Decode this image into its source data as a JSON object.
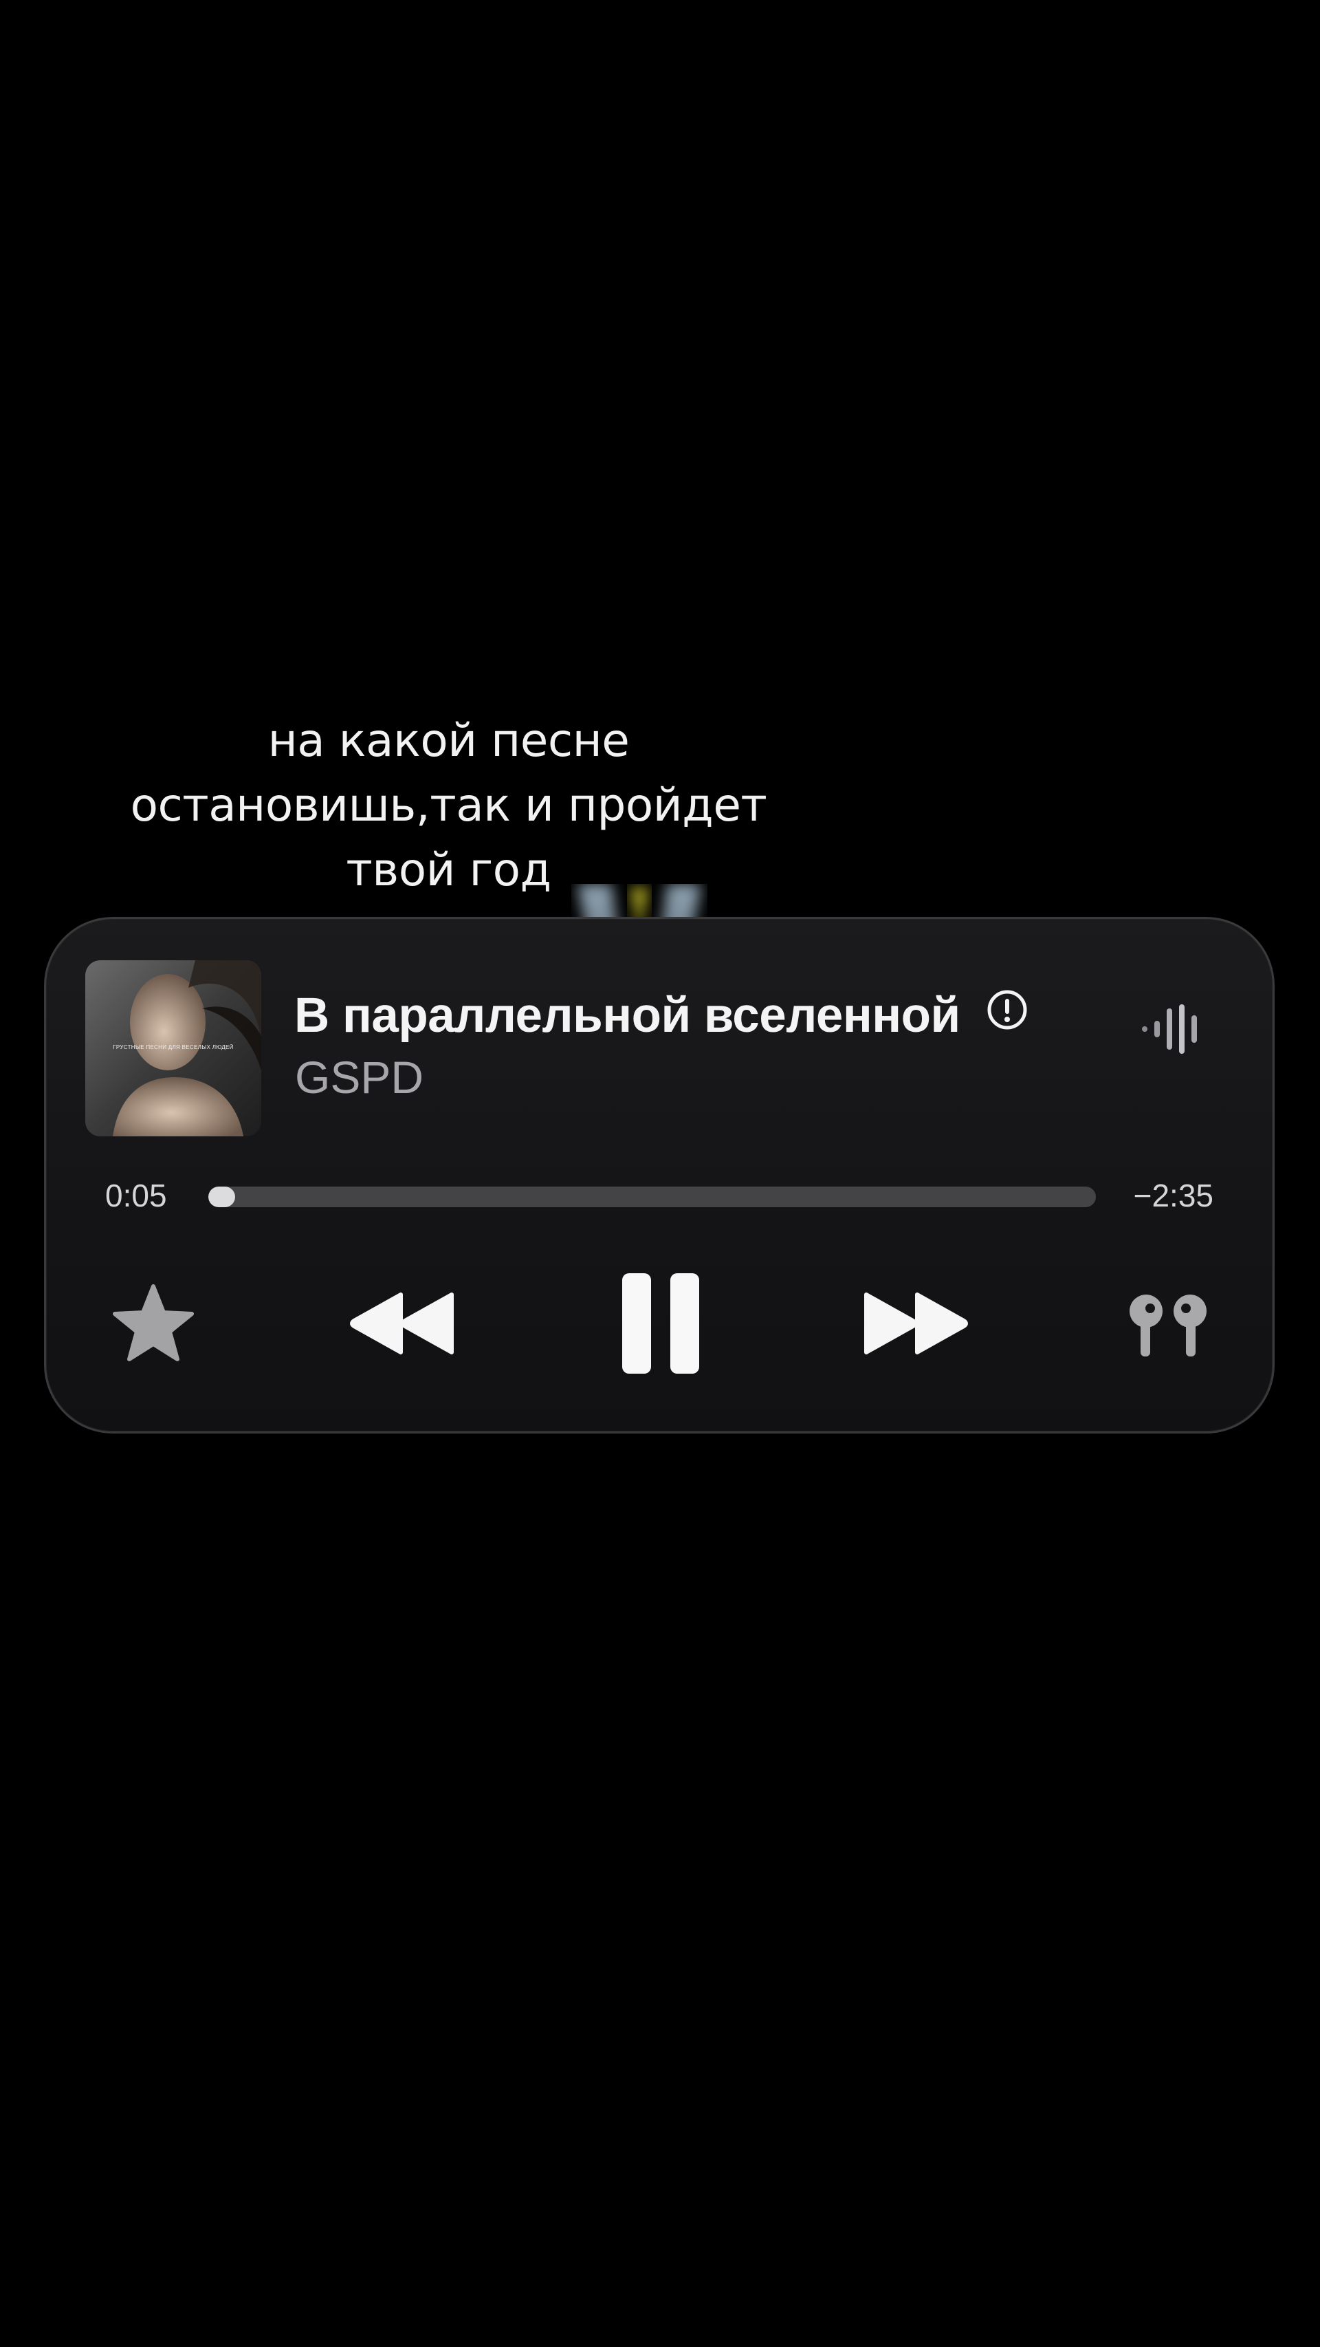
{
  "caption": {
    "line1": "на какой песне",
    "line2": "остановишь,так и пройдет",
    "line3": "твой год"
  },
  "player": {
    "album_art_strip": "ГРУСТНЫЕ ПЕСНИ ДЛЯ ВЕСЕЛЫХ ЛЮДЕЙ",
    "title": "В параллельной вселенной",
    "artist": "GSPD",
    "elapsed": "0:05",
    "remaining": "−2:35",
    "progress": 0.03,
    "icons": {
      "explicit": "explicit-icon",
      "waveform": "waveform-icon",
      "favorite": "star-icon",
      "rewind": "rewind-icon",
      "pause": "pause-icon",
      "forward": "fast-forward-icon",
      "output": "airpods-icon"
    }
  },
  "colors": {
    "background": "#000000",
    "widget_background": "#161618",
    "title": "#f4f4f4",
    "artist": "#a7a7ab",
    "progress_fill": "#dcdcde",
    "progress_track": "#444447"
  }
}
